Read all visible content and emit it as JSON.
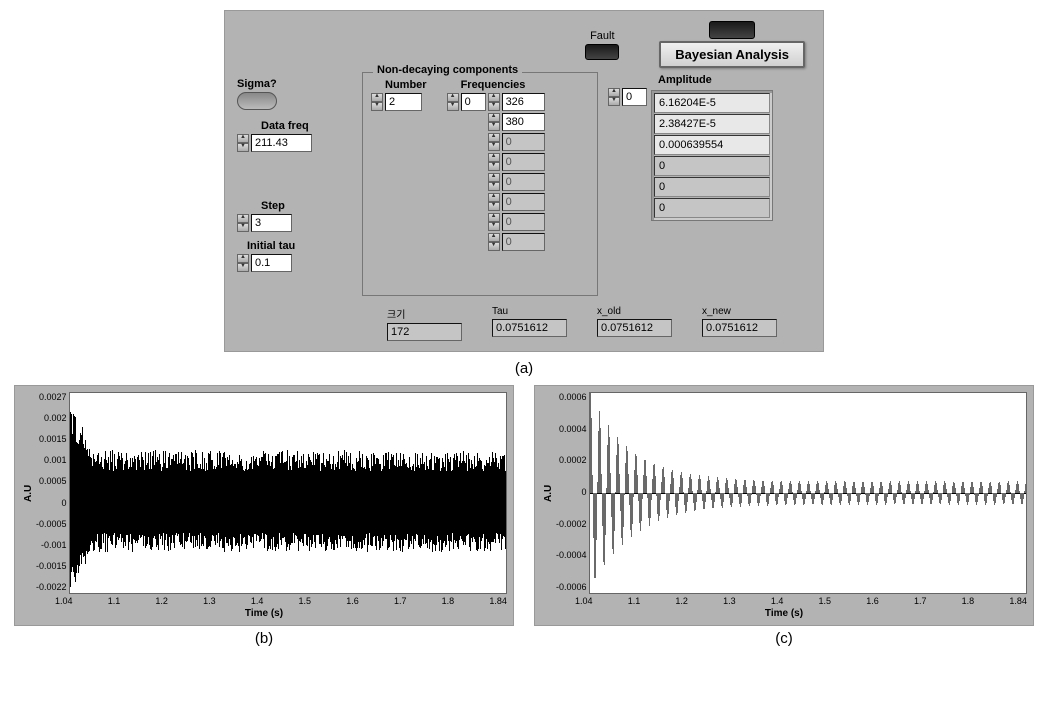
{
  "panel_a": {
    "fault_label": "Fault",
    "bayesian_button": "Bayesian Analysis",
    "sigma_label": "Sigma?",
    "data_freq_label": "Data freq",
    "data_freq": "211.43",
    "step_label": "Step",
    "step": "3",
    "initial_tau_label": "Initial tau",
    "initial_tau": "0.1",
    "nondecay": {
      "title": "Non-decaying components",
      "number_label": "Number",
      "number": "2",
      "frequencies_label": "Frequencies",
      "freq_index": "0",
      "frequencies": [
        "326",
        "380",
        "0",
        "0",
        "0",
        "0",
        "0",
        "0"
      ]
    },
    "amplitude": {
      "label": "Amplitude",
      "index": "0",
      "values": [
        "6.16204E-5",
        "2.38427E-5",
        "0.000639554",
        "0",
        "0",
        "0"
      ]
    },
    "bottom": {
      "size_label": "크기",
      "size": "172",
      "tau_label": "Tau",
      "tau": "0.0751612",
      "xold_label": "x_old",
      "xold": "0.0751612",
      "xnew_label": "x_new",
      "xnew": "0.0751612"
    }
  },
  "caption_a": "(a)",
  "chart_data": [
    {
      "type": "line",
      "title": "",
      "xlabel": "Time (s)",
      "ylabel": "A.U",
      "xlim": [
        1.04,
        1.84
      ],
      "ylim": [
        -0.0022,
        0.0027
      ],
      "xticks": [
        "1.04",
        "1.1",
        "1.2",
        "1.3",
        "1.4",
        "1.5",
        "1.6",
        "1.7",
        "1.8",
        "1.84"
      ],
      "yticks": [
        "0.0027",
        "0.002",
        "0.0015",
        "0.001",
        "0.0005",
        "0",
        "-0.0005",
        "-0.001",
        "-0.0015",
        "-0.0022"
      ],
      "description": "Dense high-frequency noise centered near 0 with amplitude roughly ±0.001 throughout, initial spikes up to ~0.0027 and down to ~-0.0022 at t≈1.04–1.08",
      "envelope_upper": [
        {
          "t": 1.04,
          "y": 0.0027
        },
        {
          "t": 1.08,
          "y": 0.0016
        },
        {
          "t": 1.2,
          "y": 0.0013
        },
        {
          "t": 1.4,
          "y": 0.0012
        },
        {
          "t": 1.6,
          "y": 0.0013
        },
        {
          "t": 1.84,
          "y": 0.0013
        }
      ],
      "envelope_lower": [
        {
          "t": 1.04,
          "y": -0.0022
        },
        {
          "t": 1.08,
          "y": -0.0014
        },
        {
          "t": 1.2,
          "y": -0.0012
        },
        {
          "t": 1.4,
          "y": -0.0011
        },
        {
          "t": 1.6,
          "y": -0.0012
        },
        {
          "t": 1.84,
          "y": -0.0012
        }
      ]
    },
    {
      "type": "line",
      "title": "",
      "xlabel": "Time (s)",
      "ylabel": "A.U",
      "xlim": [
        1.04,
        1.84
      ],
      "ylim": [
        -0.0006,
        0.0006
      ],
      "xticks": [
        "1.04",
        "1.1",
        "1.2",
        "1.3",
        "1.4",
        "1.5",
        "1.6",
        "1.7",
        "1.8",
        "1.84"
      ],
      "yticks": [
        "0.0006",
        "0.0004",
        "0.0002",
        "0",
        "-0.0002",
        "-0.0004",
        "-0.0006"
      ],
      "description": "Exponentially-decaying oscillation (ring-down), peaks ~±0.0006 at t≈1.04 decaying to steady ±0.00007 by t≈1.4 then roughly constant amplitude to 1.84",
      "envelope_upper": [
        {
          "t": 1.04,
          "y": 0.0006
        },
        {
          "t": 1.1,
          "y": 0.00035
        },
        {
          "t": 1.2,
          "y": 0.00018
        },
        {
          "t": 1.3,
          "y": 0.0001
        },
        {
          "t": 1.4,
          "y": 8e-05
        },
        {
          "t": 1.84,
          "y": 7e-05
        }
      ],
      "envelope_lower": [
        {
          "t": 1.04,
          "y": -0.0006
        },
        {
          "t": 1.1,
          "y": -0.00035
        },
        {
          "t": 1.2,
          "y": -0.00018
        },
        {
          "t": 1.3,
          "y": -0.0001
        },
        {
          "t": 1.4,
          "y": -8e-05
        },
        {
          "t": 1.84,
          "y": -7e-05
        }
      ]
    }
  ],
  "caption_b": "(b)",
  "caption_c": "(c)"
}
